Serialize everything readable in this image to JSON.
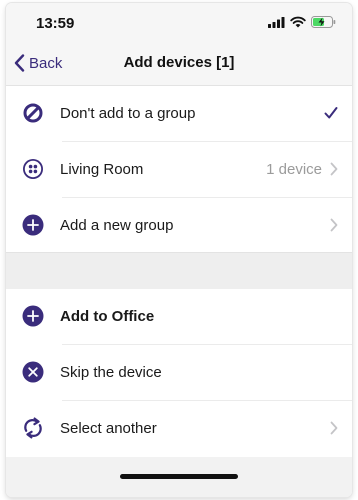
{
  "status_bar": {
    "time": "13:59",
    "icons": [
      "signal-icon",
      "wifi-icon",
      "battery-charging-icon"
    ]
  },
  "nav": {
    "back_label": "Back",
    "title": "Add devices [1]"
  },
  "group_options": [
    {
      "label": "Don't add to a group",
      "icon": "block-icon",
      "selected": true
    },
    {
      "label": "Living Room",
      "icon": "room-dots-icon",
      "detail": "1 device"
    },
    {
      "label": "Add a new group",
      "icon": "plus-circle-icon"
    }
  ],
  "actions": [
    {
      "label": "Add to Office",
      "icon": "plus-circle-icon"
    },
    {
      "label": "Skip the device",
      "icon": "x-circle-icon"
    },
    {
      "label": "Select another",
      "icon": "rotate-arrows-icon"
    }
  ],
  "colors": {
    "accent": "#3a2c7c",
    "secondary_text": "#9b9b9b",
    "chevron": "#c4c4c7",
    "section_gap": "#eeeeee"
  }
}
